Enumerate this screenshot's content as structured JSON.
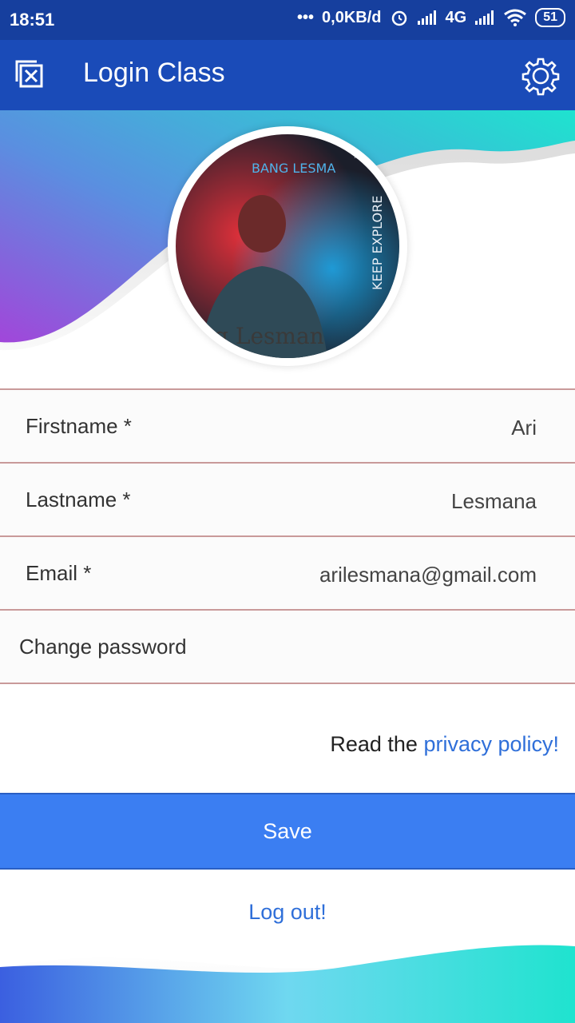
{
  "status_bar": {
    "time": "18:51",
    "dots": "•••",
    "speed": "0,0KB/d",
    "network": "4G",
    "battery": "51"
  },
  "app_bar": {
    "title": "Login Class"
  },
  "profile": {
    "photo_caption_top": "BANG LESMA",
    "photo_caption_side": "KEEP EXPLORE",
    "photo_caption_bottom": "ng Lesman"
  },
  "form": {
    "firstname": {
      "label": "Firstname *",
      "value": "Ari"
    },
    "lastname": {
      "label": "Lastname *",
      "value": "Lesmana"
    },
    "email": {
      "label": "Email *",
      "value": "arilesmana@gmail.com"
    },
    "change_password": "Change password"
  },
  "privacy": {
    "prefix": "Read the ",
    "link": "privacy policy!"
  },
  "buttons": {
    "save": "Save",
    "logout": "Log out!"
  },
  "colors": {
    "status_bar": "#163f9e",
    "app_bar": "#1a4bb8",
    "accent": "#3b7ef2",
    "link": "#2f6fd9"
  }
}
